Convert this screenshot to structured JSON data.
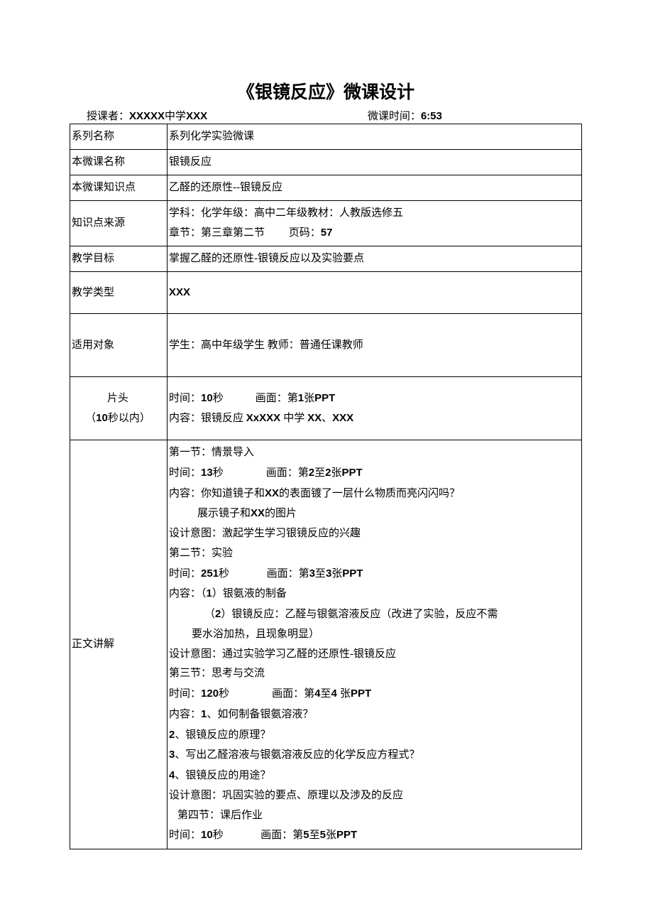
{
  "title": "《银镜反应》微课设计",
  "meta": {
    "lecturer_label": "授课者：",
    "lecturer_school_bold": "XXXXX",
    "lecturer_school_tail": "中学",
    "lecturer_name": "XXX",
    "time_label": "微课时间：",
    "time_value": "6:53"
  },
  "rows": {
    "series": {
      "label": "系列名称",
      "value": "系列化学实验微课"
    },
    "course": {
      "label": "本微课名称",
      "value": "银镜反应"
    },
    "kp": {
      "label": "本微课知识点",
      "value": "乙醛的还原性--银镜反应"
    },
    "source": {
      "label": "知识点来源",
      "line1": "学科：化学年级：高中二年级教材：人教版选修五",
      "line2_a": "章节：第三章第二节",
      "line2_b": "页码：",
      "line2_c": "57"
    },
    "goal": {
      "label": "教学目标",
      "value": "掌握乙醛的还原性-银镜反应以及实验要点"
    },
    "type": {
      "label": "教学类型",
      "value": "XXX"
    },
    "audience": {
      "label": "适用对象",
      "value": "学生：高中年级学生  教师：普通任课教师"
    },
    "opening": {
      "label_l1": "片头",
      "label_l2_a": "（",
      "label_l2_b": "10",
      "label_l2_c": "秒以内）",
      "line1_a": "时间：",
      "line1_b": "10",
      "line1_c": "秒",
      "line1_d": "画面：第",
      "line1_e": "1",
      "line1_f": "张",
      "line1_g": "PPT",
      "line2_a": "内容：银镜反应 ",
      "line2_b": "XxXXX ",
      "line2_c": "中学 ",
      "line2_d": "XX",
      "line2_e": "、",
      "line2_f": "XXX"
    },
    "body": {
      "label": "正文讲解",
      "s1": {
        "title": "第一节：情景导入",
        "time_a": "时间：",
        "time_b": "13",
        "time_c": "秒",
        "screen_a": "画面：第",
        "screen_b": "2",
        "screen_c": "至",
        "screen_d": "2",
        "screen_e": "张",
        "screen_f": "PPT",
        "content_a": "内容：你知道镜子和",
        "content_b": "XX",
        "content_c": "的表面镀了一层什么物质而亮闪闪吗？",
        "content2_a": "展示镜子和",
        "content2_b": "XX",
        "content2_c": "的图片",
        "intent": "设计意图：激起学生学习银镜反应的兴趣"
      },
      "s2": {
        "title": "第二节：实验",
        "time_a": "时间：",
        "time_b": "251",
        "time_c": "秒",
        "screen_a": "画面：第",
        "screen_b": "3",
        "screen_c": "至",
        "screen_d": "3",
        "screen_e": "张",
        "screen_f": "PPT",
        "content1_a": "内容：（",
        "content1_b": "1",
        "content1_c": "）银氨液的制备",
        "content2_a": "（",
        "content2_b": "2",
        "content2_c": "）银镜反应：乙醛与银氨溶液反应（改进了实验，反应不需",
        "content2_d": "要水浴加热，且现象明显）",
        "intent": "设计意图：通过实验学习乙醛的还原性-银镜反应"
      },
      "s3": {
        "title": "第三节：思考与交流",
        "time_a": "时间：",
        "time_b": "120",
        "time_c": "秒",
        "screen_a": "画面：第",
        "screen_b": "4",
        "screen_c": "至",
        "screen_d": "4 ",
        "screen_e": "张",
        "screen_f": "PPT",
        "q1_a": "内容：",
        "q1_b": "1",
        "q1_c": "、如何制备银氨溶液？",
        "q2_a": "2",
        "q2_b": "、银镜反应的原理？",
        "q3_a": "3",
        "q3_b": "、写出乙醛溶液与银氨溶液反应的化学反应方程式？",
        "q4_a": "4",
        "q4_b": "、银镜反应的用途？",
        "intent": "设计意图：巩固实验的要点、原理以及涉及的反应"
      },
      "s4": {
        "title": "第四节：课后作业",
        "time_a": "时间：",
        "time_b": "10",
        "time_c": "秒",
        "screen_a": "画面：第",
        "screen_b": "5",
        "screen_c": "至",
        "screen_d": "5",
        "screen_e": "张",
        "screen_f": "PPT"
      }
    }
  }
}
